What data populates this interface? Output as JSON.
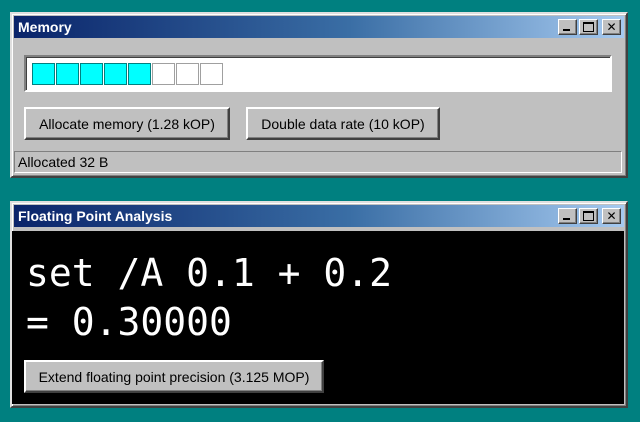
{
  "memory_window": {
    "title": "Memory",
    "cells_total": 8,
    "cells_filled": 5,
    "cell_color": "#00ffff",
    "allocate_label": "Allocate memory (1.28 kOP)",
    "double_label": "Double data rate (10 kOP)",
    "status": "Allocated 32 B"
  },
  "fp_window": {
    "title": "Floating Point Analysis",
    "line1": "set /A 0.1 + 0.2",
    "line2": "= 0.30000",
    "extend_label": "Extend floating point precision (3.125 MOP)"
  },
  "icons": {
    "minimize": "minimize-icon",
    "maximize": "maximize-icon",
    "close": "close-icon"
  },
  "colors": {
    "desktop": "#008080",
    "title_start": "#0a246a",
    "title_end": "#a6caf0"
  }
}
